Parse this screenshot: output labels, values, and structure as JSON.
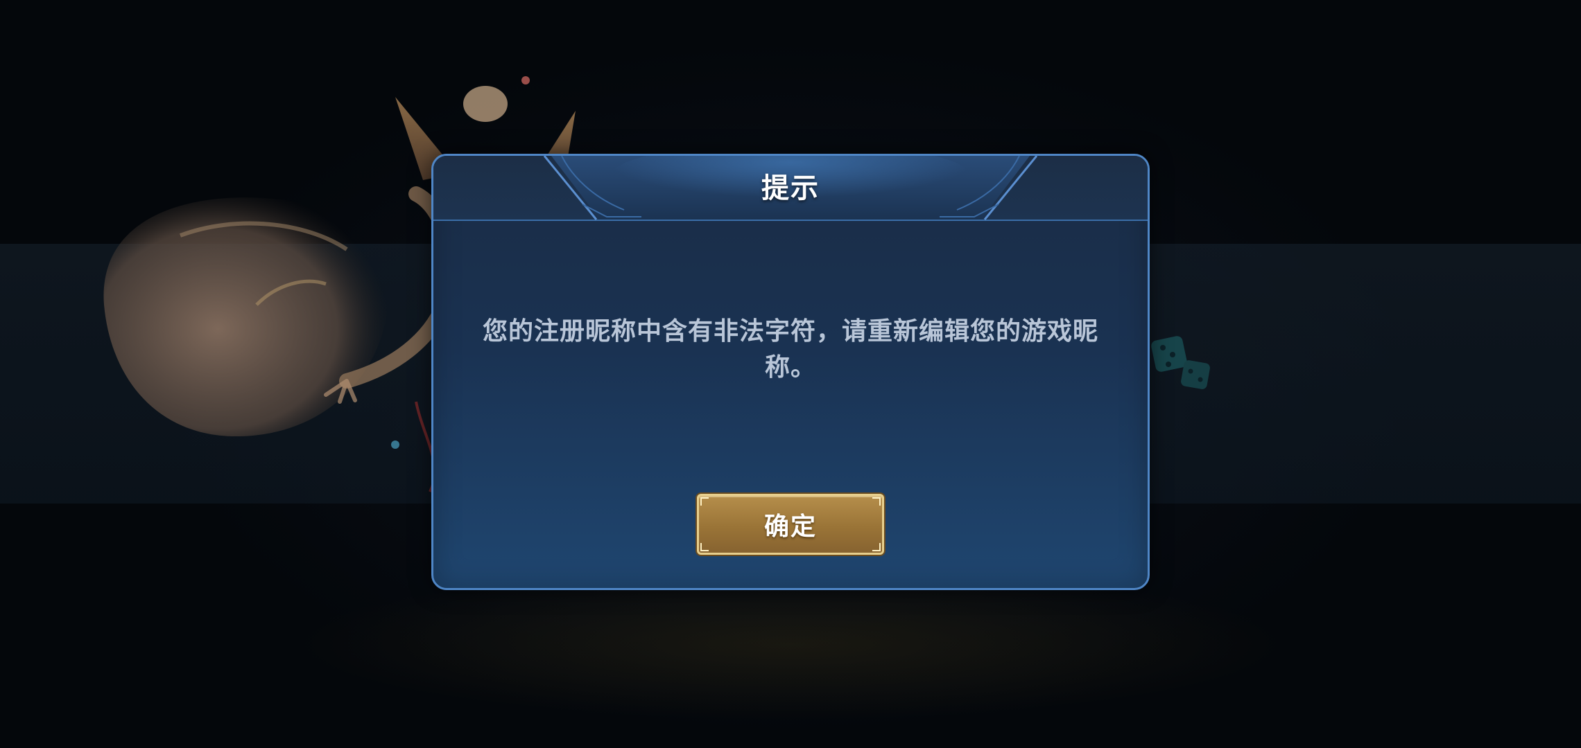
{
  "background": {
    "faded_prompt_text": "",
    "faded_button_text": "",
    "hero_icon": "fox-heroine-illustration",
    "dice_icon": "dice-icon"
  },
  "dialog": {
    "title": "提示",
    "message": "您的注册昵称中含有非法字符，请重新编辑您的游戏昵称。",
    "confirm_label": "确定"
  },
  "colors": {
    "dialog_border": "#4f86c6",
    "dialog_bg_top": "#1a2c45",
    "dialog_bg_bottom": "#1f4670",
    "button_gold": "#9a7437",
    "button_border": "#e7cf8d",
    "message_text": "#b9c6d8"
  }
}
